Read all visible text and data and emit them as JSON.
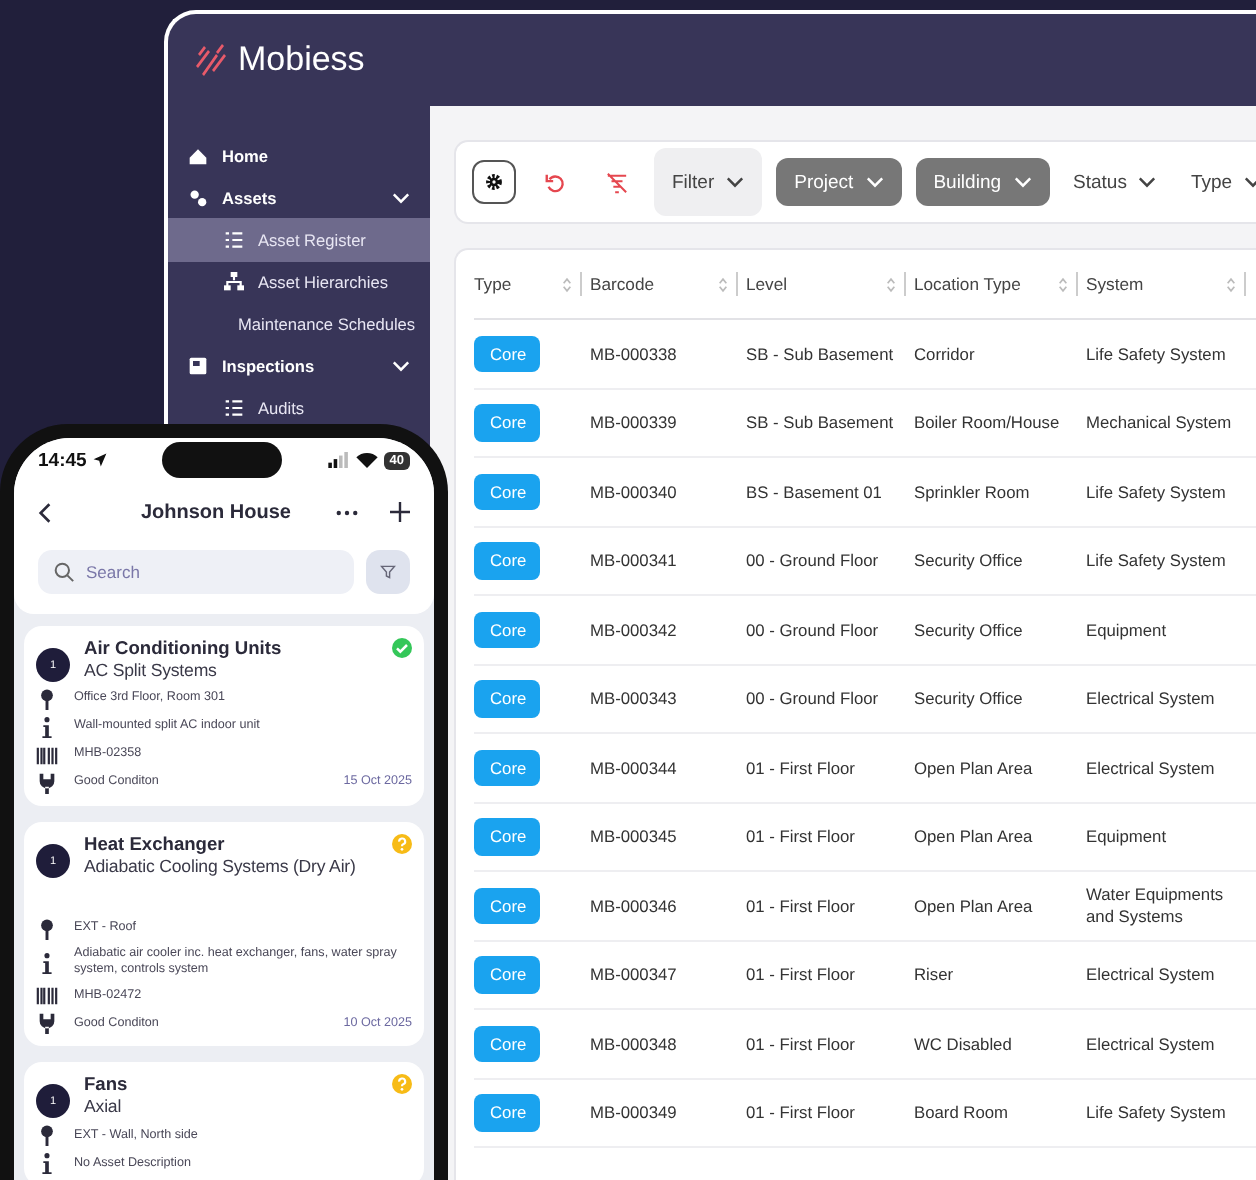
{
  "app": {
    "brand": "Mobiess"
  },
  "sidebar": {
    "items": [
      {
        "label": "Home",
        "expanded": false,
        "selected": false
      },
      {
        "label": "Assets",
        "expanded": true,
        "selected": false,
        "children": [
          {
            "label": "Asset Register",
            "selected": true
          },
          {
            "label": "Asset Hierarchies",
            "selected": false
          },
          {
            "label": "Maintenance Schedules",
            "selected": false
          }
        ]
      },
      {
        "label": "Inspections",
        "expanded": true,
        "selected": false,
        "children": [
          {
            "label": "Audits",
            "selected": false
          }
        ]
      }
    ]
  },
  "toolbar": {
    "filters": [
      {
        "label": "Filter",
        "kind": "tinted"
      },
      {
        "label": "Project",
        "kind": "solid"
      },
      {
        "label": "Building",
        "kind": "solid"
      },
      {
        "label": "Status",
        "kind": "plain"
      },
      {
        "label": "Type",
        "kind": "plain"
      }
    ]
  },
  "table": {
    "columns": [
      "Type",
      "Barcode",
      "Level",
      "Location Type",
      "System"
    ],
    "rows": [
      {
        "type": "Core",
        "barcode": "MB-000338",
        "level": "SB - Sub Basement",
        "location_type": "Corridor",
        "system": "Life Safety System"
      },
      {
        "type": "Core",
        "barcode": "MB-000339",
        "level": "SB - Sub Basement",
        "location_type": "Boiler Room/House",
        "system": "Mechanical System"
      },
      {
        "type": "Core",
        "barcode": "MB-000340",
        "level": "BS - Basement 01",
        "location_type": "Sprinkler Room",
        "system": "Life Safety System"
      },
      {
        "type": "Core",
        "barcode": "MB-000341",
        "level": "00 - Ground Floor",
        "location_type": "Security Office",
        "system": "Life Safety System"
      },
      {
        "type": "Core",
        "barcode": "MB-000342",
        "level": "00 - Ground Floor",
        "location_type": "Security Office",
        "system": "Equipment"
      },
      {
        "type": "Core",
        "barcode": "MB-000343",
        "level": "00 - Ground Floor",
        "location_type": "Security Office",
        "system": "Electrical System"
      },
      {
        "type": "Core",
        "barcode": "MB-000344",
        "level": "01 - First Floor",
        "location_type": "Open Plan Area",
        "system": "Electrical System"
      },
      {
        "type": "Core",
        "barcode": "MB-000345",
        "level": "01 - First Floor",
        "location_type": "Open Plan Area",
        "system": "Equipment"
      },
      {
        "type": "Core",
        "barcode": "MB-000346",
        "level": "01 - First Floor",
        "location_type": "Open Plan Area",
        "system": "Water Equipments and Systems"
      },
      {
        "type": "Core",
        "barcode": "MB-000347",
        "level": "01 - First Floor",
        "location_type": "Riser",
        "system": "Electrical System"
      },
      {
        "type": "Core",
        "barcode": "MB-000348",
        "level": "01 - First Floor",
        "location_type": "WC  Disabled",
        "system": "Electrical System"
      },
      {
        "type": "Core",
        "barcode": "MB-000349",
        "level": "01 - First Floor",
        "location_type": "Board Room",
        "system": "Life Safety System"
      }
    ]
  },
  "phone": {
    "status_bar": {
      "time": "14:45",
      "battery": "40"
    },
    "title": "Johnson House",
    "search": {
      "placeholder": "Search"
    },
    "assets": [
      {
        "number": "1",
        "title": "Air Conditioning Units",
        "subtitle": "AC Split Systems",
        "done": true,
        "location": "Office 3rd Floor, Room 301",
        "description": "Wall-mounted split AC indoor unit",
        "barcode": "MHB-02358",
        "condition": "Good Conditon",
        "date": "15 Oct 2025"
      },
      {
        "number": "1",
        "title": "Heat Exchanger",
        "subtitle": "Adiabatic Cooling Systems (Dry Air)",
        "done": false,
        "location": "EXT - Roof",
        "description": "Adiabatic air cooler inc. heat exchanger, fans, water spray system, controls system",
        "barcode": "MHB-02472",
        "condition": "Good Conditon",
        "date": "10 Oct 2025"
      },
      {
        "number": "1",
        "title": "Fans",
        "subtitle": "Axial",
        "done": false,
        "location": "EXT - Wall, North side",
        "description": "No Asset Description"
      }
    ]
  }
}
